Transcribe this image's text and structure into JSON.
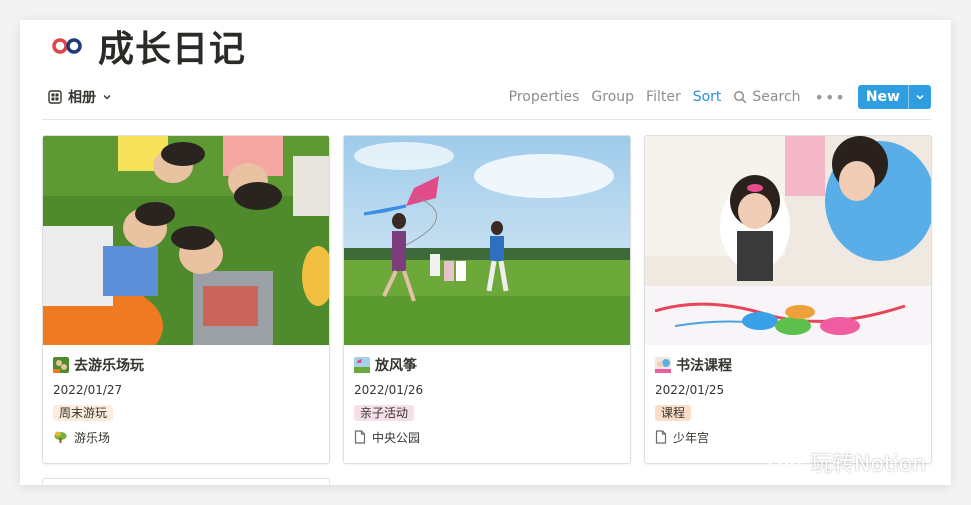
{
  "page": {
    "title": "成长日记",
    "icon": "infinity-icon",
    "accent": "#2f9ee0"
  },
  "toolbar": {
    "view_icon": "gallery-grid-icon",
    "view_label": "相册",
    "properties": "Properties",
    "group": "Group",
    "filter": "Filter",
    "sort": "Sort",
    "search": "Search",
    "more": "•••",
    "new": "New"
  },
  "cards": [
    {
      "name": "去游乐场玩",
      "date": "2022/01/27",
      "tag": "周末游玩",
      "tag_bg": "#fbecdd",
      "place_icon": "amusement-park-icon",
      "place": "游乐场",
      "cover": "children-lying-on-grass-photo"
    },
    {
      "name": "放风筝",
      "date": "2022/01/26",
      "tag": "亲子活动",
      "tag_bg": "#f4dfeb",
      "place_icon": "page-icon",
      "place": "中央公园",
      "cover": "family-flying-kite-photo"
    },
    {
      "name": "书法课程",
      "date": "2022/01/25",
      "tag": "课程",
      "tag_bg": "#fadec9",
      "place_icon": "page-icon",
      "place": "少年宫",
      "cover": "mother-and-girl-painting-photo"
    }
  ],
  "watermark": {
    "icon": "wechat-icon",
    "text": "玩转Notion"
  }
}
